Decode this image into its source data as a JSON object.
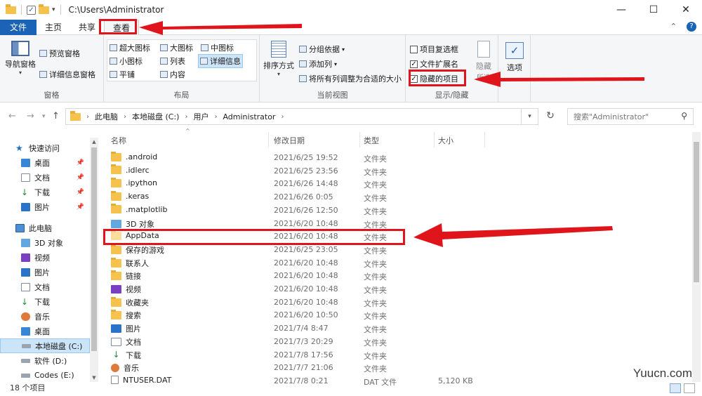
{
  "window": {
    "path": "C:\\Users\\Administrator",
    "controls": [
      "—",
      "☐",
      "✕"
    ]
  },
  "tabs": [
    {
      "label": "文件",
      "active": false,
      "file": true
    },
    {
      "label": "主页",
      "active": false
    },
    {
      "label": "共享",
      "active": false
    },
    {
      "label": "查看",
      "active": true
    }
  ],
  "ribbon": {
    "pane_group": {
      "label": "窗格",
      "nav_pane": "导航窗格",
      "preview": "预览窗格",
      "details": "详细信息窗格"
    },
    "layout_group": {
      "label": "布局",
      "items": [
        "超大图标",
        "大图标",
        "中图标",
        "小图标",
        "列表",
        "详细信息",
        "平铺",
        "内容"
      ]
    },
    "current_view": {
      "label": "当前视图",
      "sort": "排序方式",
      "group_by": "分组依据",
      "add_column": "添加列",
      "fit_columns": "将所有列调整为合适的大小"
    },
    "show_hide": {
      "label": "显示/隐藏",
      "item_checkbox": "项目复选框",
      "extensions": "文件扩展名",
      "hidden_items": "隐藏的项目",
      "hide": "隐藏",
      "hide_sub": "所选"
    },
    "options": "选项"
  },
  "address": {
    "crumbs": [
      "此电脑",
      "本地磁盘 (C:)",
      "用户",
      "Administrator"
    ],
    "search_placeholder": "搜索\"Administrator\""
  },
  "nav": {
    "quick_access": "快速访问",
    "quick_items": [
      "桌面",
      "文档",
      "下载",
      "图片"
    ],
    "this_pc": "此电脑",
    "pc_items": [
      "3D 对象",
      "视频",
      "图片",
      "文档",
      "下载",
      "音乐",
      "桌面",
      "本地磁盘 (C:)",
      "软件 (D:)",
      "Codes (E:)"
    ]
  },
  "columns": {
    "name": "名称",
    "date": "修改日期",
    "type": "类型",
    "size": "大小"
  },
  "files": [
    {
      "name": ".android",
      "date": "2021/6/25 19:52",
      "type": "文件夹",
      "size": "",
      "icon": "folder"
    },
    {
      "name": ".idlerc",
      "date": "2021/6/25 23:56",
      "type": "文件夹",
      "size": "",
      "icon": "folder"
    },
    {
      "name": ".ipython",
      "date": "2021/6/26 14:48",
      "type": "文件夹",
      "size": "",
      "icon": "folder"
    },
    {
      "name": ".keras",
      "date": "2021/6/26 0:05",
      "type": "文件夹",
      "size": "",
      "icon": "folder"
    },
    {
      "name": ".matplotlib",
      "date": "2021/6/26 12:50",
      "type": "文件夹",
      "size": "",
      "icon": "folder"
    },
    {
      "name": "3D 对象",
      "date": "2021/6/20 10:48",
      "type": "文件夹",
      "size": "",
      "icon": "3d"
    },
    {
      "name": "AppData",
      "date": "2021/6/20 10:48",
      "type": "文件夹",
      "size": "",
      "icon": "folder-faded"
    },
    {
      "name": "保存的游戏",
      "date": "2021/6/25 23:05",
      "type": "文件夹",
      "size": "",
      "icon": "folder"
    },
    {
      "name": "联系人",
      "date": "2021/6/20 10:48",
      "type": "文件夹",
      "size": "",
      "icon": "folder"
    },
    {
      "name": "链接",
      "date": "2021/6/20 10:48",
      "type": "文件夹",
      "size": "",
      "icon": "folder"
    },
    {
      "name": "视频",
      "date": "2021/6/20 10:48",
      "type": "文件夹",
      "size": "",
      "icon": "video"
    },
    {
      "name": "收藏夹",
      "date": "2021/6/20 10:48",
      "type": "文件夹",
      "size": "",
      "icon": "folder"
    },
    {
      "name": "搜索",
      "date": "2021/6/20 10:50",
      "type": "文件夹",
      "size": "",
      "icon": "folder"
    },
    {
      "name": "图片",
      "date": "2021/7/4 8:47",
      "type": "文件夹",
      "size": "",
      "icon": "picture"
    },
    {
      "name": "文档",
      "date": "2021/7/3 20:29",
      "type": "文件夹",
      "size": "",
      "icon": "document"
    },
    {
      "name": "下载",
      "date": "2021/7/8 17:56",
      "type": "文件夹",
      "size": "",
      "icon": "download"
    },
    {
      "name": "音乐",
      "date": "2021/7/7 21:06",
      "type": "文件夹",
      "size": "",
      "icon": "music"
    },
    {
      "name": "NTUSER.DAT",
      "date": "2021/7/8 0:21",
      "type": "DAT 文件",
      "size": "5,120 KB",
      "icon": "file"
    }
  ],
  "status": {
    "count": "18 个项目"
  },
  "watermark": "Yuucn.com",
  "colors": {
    "accent": "#1a63b6",
    "annotation": "#e0151b",
    "folder": "#f4c24d"
  }
}
